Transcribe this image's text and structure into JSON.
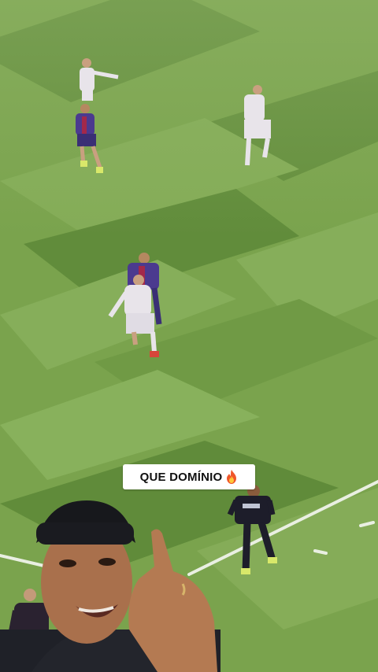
{
  "overlay": {
    "caption_text": "QUE DOMÍNIO",
    "caption_icon": "fire-icon"
  },
  "scene": {
    "description_icon_names": [
      "football-pitch",
      "players",
      "referee",
      "selfie-person"
    ],
    "colors": {
      "grass_light": "#86ad59",
      "grass_dark": "#628c3c",
      "line": "#e9efe2",
      "team_home": "#4b3a8f",
      "team_home_accent": "#a3284a",
      "team_away": "#e8e4ea",
      "caption_bg": "#ffffff"
    }
  }
}
